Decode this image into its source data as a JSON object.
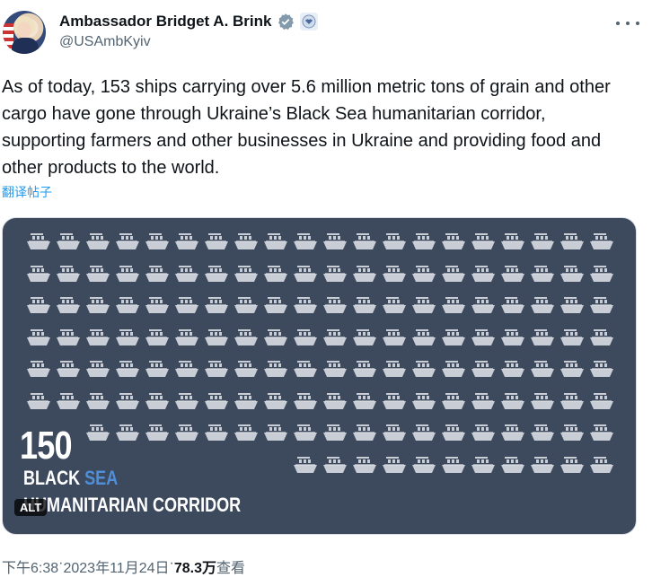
{
  "author": {
    "display_name": "Ambassador Bridget A. Brink",
    "handle": "@USAmbKyiv"
  },
  "icons": {
    "verified": "verified-badge-icon",
    "affiliation": "us-state-department-seal-icon",
    "more": "more-options-icon",
    "ship": "cargo-ship-icon"
  },
  "tweet": {
    "text": "As of today, 153 ships carrying over 5.6 million metric tons of grain and other cargo have gone through Ukraine’s Black Sea humanitarian corridor, supporting farmers and other businesses in Ukraine and providing food and other products to the world.",
    "translate_label": "翻译帖子"
  },
  "media": {
    "number": "150",
    "caption_line1_a": "BLACK ",
    "caption_line1_b": "SEA",
    "caption_line2": "HUMANITARIAN CORRIDOR",
    "alt_label": "ALT",
    "ship_count": 150,
    "colors": {
      "background": "#3d4a5e",
      "ship": "#c9ced6",
      "accent": "#4f8fd8"
    }
  },
  "meta": {
    "time": "下午6:38",
    "sep1": " · ",
    "date": "2023年11月24日",
    "sep2": " · ",
    "views_count": "78.3万",
    "views_label": " 查看"
  }
}
